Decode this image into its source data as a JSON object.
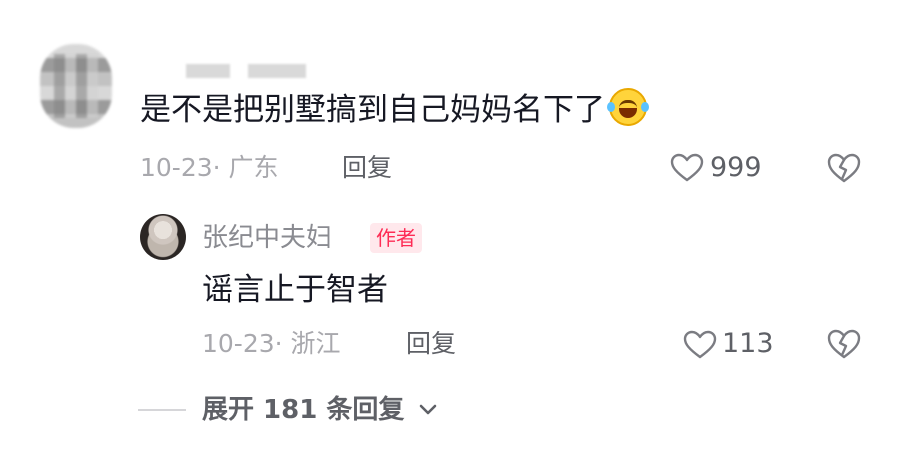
{
  "comment": {
    "text": "是不是把别墅搞到自己妈妈名下了",
    "emoji": "laughing-tears-emoji",
    "meta": "10-23· 广东",
    "reply_label": "回复",
    "like_count": "999"
  },
  "reply": {
    "username": "张纪中夫妇",
    "author_badge": "作者",
    "text": "谣言止于智者",
    "meta": "10-23· 浙江",
    "reply_label": "回复",
    "like_count": "113"
  },
  "expand": {
    "label": "展开 181 条回复"
  },
  "colors": {
    "accent": "#fe2c55",
    "badge_bg": "#ffe8ec",
    "secondary_text": "#a8a8ad",
    "action_text": "#5e6066",
    "primary_text": "#161823"
  }
}
